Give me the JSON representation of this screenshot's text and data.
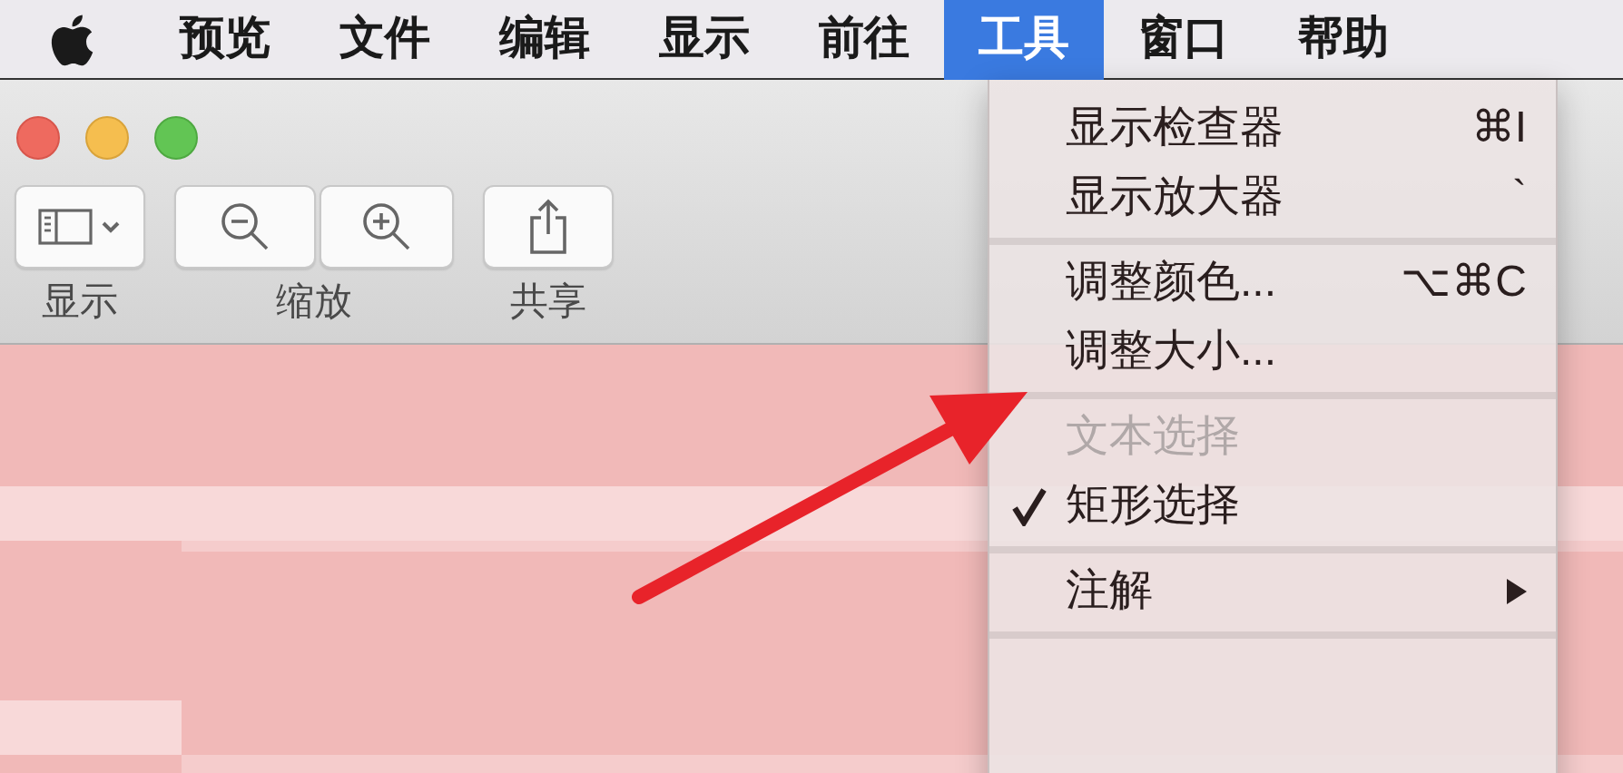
{
  "menubar": {
    "items": [
      {
        "label": "预览",
        "selected": false
      },
      {
        "label": "文件",
        "selected": false
      },
      {
        "label": "编辑",
        "selected": false
      },
      {
        "label": "显示",
        "selected": false
      },
      {
        "label": "前往",
        "selected": false
      },
      {
        "label": "工具",
        "selected": true
      },
      {
        "label": "窗口",
        "selected": false
      },
      {
        "label": "帮助",
        "selected": false
      }
    ]
  },
  "toolbar": {
    "groups": [
      {
        "label": "显示"
      },
      {
        "label": "缩放"
      },
      {
        "label": "共享"
      }
    ]
  },
  "menu": {
    "items": [
      {
        "kind": "item",
        "label": "显示检查器",
        "shortcut": "⌘I",
        "disabled": false,
        "checked": false
      },
      {
        "kind": "item",
        "label": "显示放大器",
        "shortcut": "`",
        "disabled": false,
        "checked": false
      },
      {
        "kind": "separator"
      },
      {
        "kind": "item",
        "label": "调整颜色...",
        "shortcut": "⌥⌘C",
        "disabled": false,
        "checked": false
      },
      {
        "kind": "item",
        "label": "调整大小...",
        "disabled": false,
        "checked": false
      },
      {
        "kind": "separator"
      },
      {
        "kind": "item",
        "label": "文本选择",
        "disabled": true,
        "checked": false
      },
      {
        "kind": "item",
        "label": "矩形选择",
        "disabled": false,
        "checked": true
      },
      {
        "kind": "separator"
      },
      {
        "kind": "submenu",
        "label": "注解",
        "disabled": false,
        "checked": false
      },
      {
        "kind": "separator"
      }
    ]
  }
}
